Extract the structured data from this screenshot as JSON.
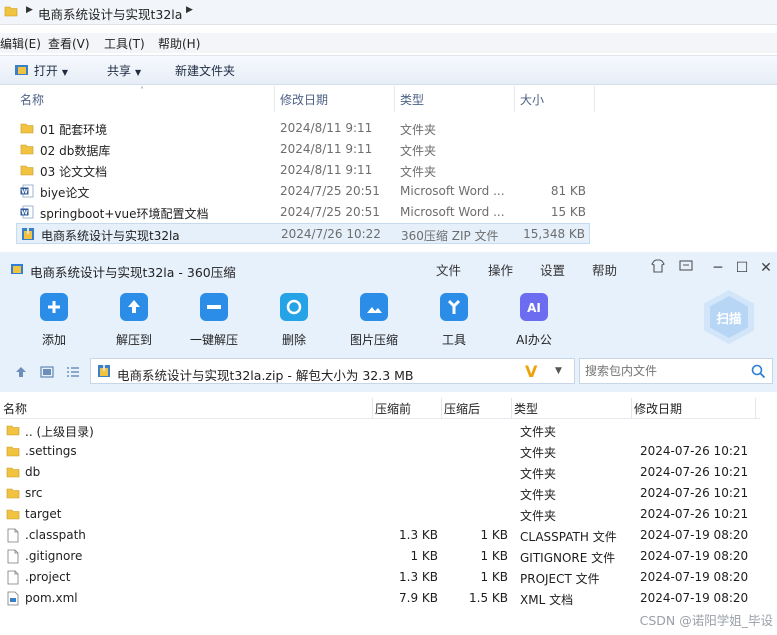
{
  "explorer": {
    "breadcrumb": "电商系统设计与实现t32la",
    "menu": [
      "编辑(E)",
      "查看(V)",
      "工具(T)",
      "帮助(H)"
    ],
    "toolbar": {
      "open": "打开",
      "share": "共享",
      "new_folder": "新建文件夹"
    },
    "columns": {
      "name": "名称",
      "date": "修改日期",
      "type": "类型",
      "size": "大小"
    },
    "files": [
      {
        "icon": "folder-icon",
        "name": "01 配套环境",
        "date": "2024/8/11 9:11",
        "type": "文件夹",
        "size": ""
      },
      {
        "icon": "folder-icon",
        "name": "02 db数据库",
        "date": "2024/8/11 9:11",
        "type": "文件夹",
        "size": ""
      },
      {
        "icon": "folder-icon",
        "name": "03 论文文档",
        "date": "2024/8/11 9:11",
        "type": "文件夹",
        "size": ""
      },
      {
        "icon": "word-icon",
        "name": "biye论文",
        "date": "2024/7/25 20:51",
        "type": "Microsoft Word ...",
        "size": "81 KB"
      },
      {
        "icon": "word-icon",
        "name": "springboot+vue环境配置文档",
        "date": "2024/7/25 20:51",
        "type": "Microsoft Word ...",
        "size": "15 KB"
      },
      {
        "icon": "zip-icon",
        "name": "电商系统设计与实现t32la",
        "date": "2024/7/26 10:22",
        "type": "360压缩 ZIP 文件",
        "size": "15,348 KB",
        "selected": true
      }
    ]
  },
  "zip": {
    "title": "电商系统设计与实现t32la - 360压缩",
    "menu": [
      "文件",
      "操作",
      "设置",
      "帮助"
    ],
    "tools": [
      {
        "label": "添加",
        "icon": "add-icon",
        "color": "#2b8de8"
      },
      {
        "label": "解压到",
        "icon": "extract-to-icon",
        "color": "#2b8de8"
      },
      {
        "label": "一键解压",
        "icon": "one-click-extract-icon",
        "color": "#2b8de8"
      },
      {
        "label": "删除",
        "icon": "delete-icon",
        "color": "#26a2e6"
      },
      {
        "label": "图片压缩",
        "icon": "image-compress-icon",
        "color": "#2b8de8"
      },
      {
        "label": "工具",
        "icon": "tools-icon",
        "color": "#2b8de8"
      },
      {
        "label": "AI办公",
        "icon": "ai-office-icon",
        "color": "#6c6cf0"
      }
    ],
    "scan_label": "扫描",
    "path": "电商系统设计与实现t32la.zip - 解包大小为 32.3 MB",
    "search_placeholder": "搜索包内文件",
    "columns": {
      "name": "名称",
      "packed": "压缩前",
      "compressed": "压缩后",
      "type": "类型",
      "modified": "修改日期"
    },
    "entries": [
      {
        "icon": "folder-icon",
        "name": ".. (上级目录)",
        "packed": "",
        "compressed": "",
        "type": "文件夹",
        "modified": ""
      },
      {
        "icon": "folder-icon",
        "name": ".settings",
        "packed": "",
        "compressed": "",
        "type": "文件夹",
        "modified": "2024-07-26 10:21"
      },
      {
        "icon": "folder-icon",
        "name": "db",
        "packed": "",
        "compressed": "",
        "type": "文件夹",
        "modified": "2024-07-26 10:21"
      },
      {
        "icon": "folder-icon",
        "name": "src",
        "packed": "",
        "compressed": "",
        "type": "文件夹",
        "modified": "2024-07-26 10:21"
      },
      {
        "icon": "folder-icon",
        "name": "target",
        "packed": "",
        "compressed": "",
        "type": "文件夹",
        "modified": "2024-07-26 10:21"
      },
      {
        "icon": "file-icon",
        "name": ".classpath",
        "packed": "1.3 KB",
        "compressed": "1 KB",
        "type": "CLASSPATH 文件",
        "modified": "2024-07-19 08:20"
      },
      {
        "icon": "file-icon",
        "name": ".gitignore",
        "packed": "1 KB",
        "compressed": "1 KB",
        "type": "GITIGNORE 文件",
        "modified": "2024-07-19 08:20"
      },
      {
        "icon": "file-icon",
        "name": ".project",
        "packed": "1.3 KB",
        "compressed": "1 KB",
        "type": "PROJECT 文件",
        "modified": "2024-07-19 08:20"
      },
      {
        "icon": "xml-icon",
        "name": "pom.xml",
        "packed": "7.9 KB",
        "compressed": "1.5 KB",
        "type": "XML 文档",
        "modified": "2024-07-19 08:20"
      }
    ]
  },
  "watermark": "CSDN @诺阳学姐_毕设"
}
